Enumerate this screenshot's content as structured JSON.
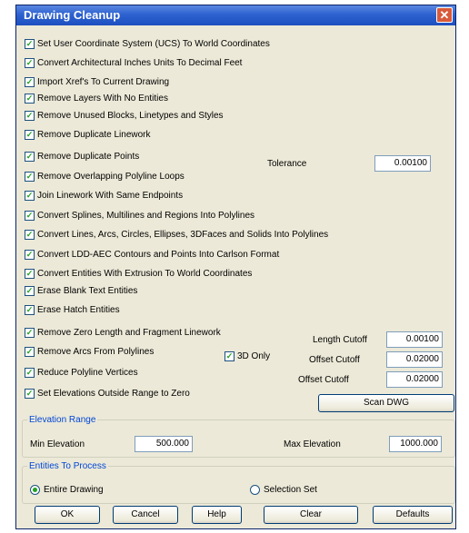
{
  "window": {
    "title": "Drawing Cleanup",
    "close_glyph": "✕"
  },
  "check_glyph": "✓",
  "options": [
    {
      "label": "Set User Coordinate System (UCS) To World Coordinates",
      "checked": true
    },
    {
      "label": "Convert Architectural Inches Units To Decimal Feet",
      "checked": true
    },
    {
      "label": "Import Xref's To Current Drawing",
      "checked": true
    },
    {
      "label": "Remove Layers With No Entities",
      "checked": true
    },
    {
      "label": "Remove Unused Blocks, Linetypes and Styles",
      "checked": true
    },
    {
      "label": "Remove Duplicate Linework",
      "checked": true
    },
    {
      "label": "Remove Duplicate Points",
      "checked": true
    },
    {
      "label": "Remove Overlapping Polyline Loops",
      "checked": true
    },
    {
      "label": "Join Linework With Same Endpoints",
      "checked": true
    },
    {
      "label": "Convert Splines, Multilines and Regions Into Polylines",
      "checked": true
    },
    {
      "label": "Convert Lines, Arcs, Circles, Ellipses, 3DFaces and Solids Into Polylines",
      "checked": true
    },
    {
      "label": "Convert LDD-AEC Contours and Points Into Carlson Format",
      "checked": true
    },
    {
      "label": "Convert Entities With Extrusion To World Coordinates",
      "checked": true
    },
    {
      "label": "Erase Blank Text Entities",
      "checked": true
    },
    {
      "label": "Erase Hatch Entities",
      "checked": true
    },
    {
      "label": "Remove Zero Length and Fragment Linework",
      "checked": true
    },
    {
      "label": "Remove Arcs From Polylines",
      "checked": true
    },
    {
      "label": "Reduce Polyline Vertices",
      "checked": true
    },
    {
      "label": "Set Elevations Outside Range to Zero",
      "checked": true
    }
  ],
  "three_d_only": {
    "label": "3D Only",
    "checked": true
  },
  "tolerance": {
    "label": "Tolerance",
    "value": "0.00100"
  },
  "length_cutoff": {
    "label": "Length Cutoff",
    "value": "0.00100"
  },
  "offset_cutoff_arcs": {
    "label": "Offset Cutoff",
    "value": "0.02000"
  },
  "offset_cutoff_vertices": {
    "label": "Offset Cutoff",
    "value": "0.02000"
  },
  "scan_button": "Scan DWG",
  "elevation_range": {
    "title": "Elevation Range",
    "min_label": "Min Elevation",
    "min_value": "500.000",
    "max_label": "Max Elevation",
    "max_value": "1000.000"
  },
  "entities": {
    "title": "Entities To Process",
    "entire_drawing": "Entire Drawing",
    "selection_set": "Selection Set",
    "selected": "entire_drawing"
  },
  "buttons": {
    "ok": "OK",
    "cancel": "Cancel",
    "help": "Help",
    "clear": "Clear",
    "defaults": "Defaults"
  }
}
